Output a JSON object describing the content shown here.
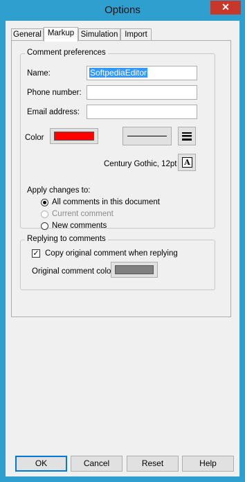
{
  "window": {
    "title": "Options",
    "close_glyph": "✕"
  },
  "tabs": [
    {
      "label": "General",
      "active": false
    },
    {
      "label": "Markup",
      "active": true
    },
    {
      "label": "Simulation",
      "active": false
    },
    {
      "label": "Import",
      "active": false
    }
  ],
  "comment_preferences": {
    "legend": "Comment preferences",
    "name_label": "Name:",
    "name_value": "SoftpediaEditor",
    "phone_label": "Phone number:",
    "phone_value": "",
    "email_label": "Email address:",
    "email_value": "",
    "color_label": "Color",
    "color_value": "#ff0000",
    "font_text": "Century Gothic, 12pt",
    "font_button_glyph": "A",
    "apply_label": "Apply changes to:",
    "apply_options": [
      {
        "label": "All comments in this document",
        "checked": true,
        "disabled": false
      },
      {
        "label": "Current comment",
        "checked": false,
        "disabled": true
      },
      {
        "label": "New comments",
        "checked": false,
        "disabled": false
      }
    ]
  },
  "replying": {
    "legend": "Replying to comments",
    "copy_label": "Copy original comment when replying",
    "copy_checked": true,
    "original_color_label": "Original comment color",
    "original_color_value": "#808080"
  },
  "footer": {
    "ok": "OK",
    "cancel": "Cancel",
    "reset": "Reset",
    "help": "Help"
  }
}
